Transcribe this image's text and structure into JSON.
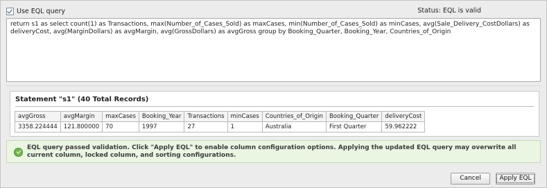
{
  "header": {
    "use_eql_label": "Use EQL query",
    "use_eql_checked": true,
    "status_text": "Status:  EQL is valid"
  },
  "editor": {
    "query_text": "return s1 as select count(1) as Transactions, max(Number_of_Cases_Sold) as maxCases, min(Number_of_Cases_Sold) as minCases, avg(Sale_Delivery_CostDollars) as\ndeliveryCost, avg(MarginDollars) as avgMargin, avg(GrossDollars) as avgGross group by Booking_Quarter, Booking_Year, Countries_of_Origin"
  },
  "statement": {
    "title": "Statement \"s1\" (40 Total Records)",
    "columns": [
      "avgGross",
      "avgMargin",
      "maxCases",
      "Booking_Year",
      "Transactions",
      "minCases",
      "Countries_of_Origin",
      "Booking_Quarter",
      "deliveryCost"
    ],
    "rows": [
      [
        "3358.224444",
        "121.800000",
        "70",
        "1997",
        "27",
        "1",
        "Australia",
        "First Quarter",
        "59.962222"
      ]
    ]
  },
  "validation": {
    "message": "EQL query passed validation. Click \"Apply EQL\" to enable column configuration options. Applying the updated EQL query may overwrite all current column, locked column, and sorting configurations."
  },
  "buttons": {
    "cancel_label": "Cancel",
    "apply_label": "Apply EQL"
  }
}
